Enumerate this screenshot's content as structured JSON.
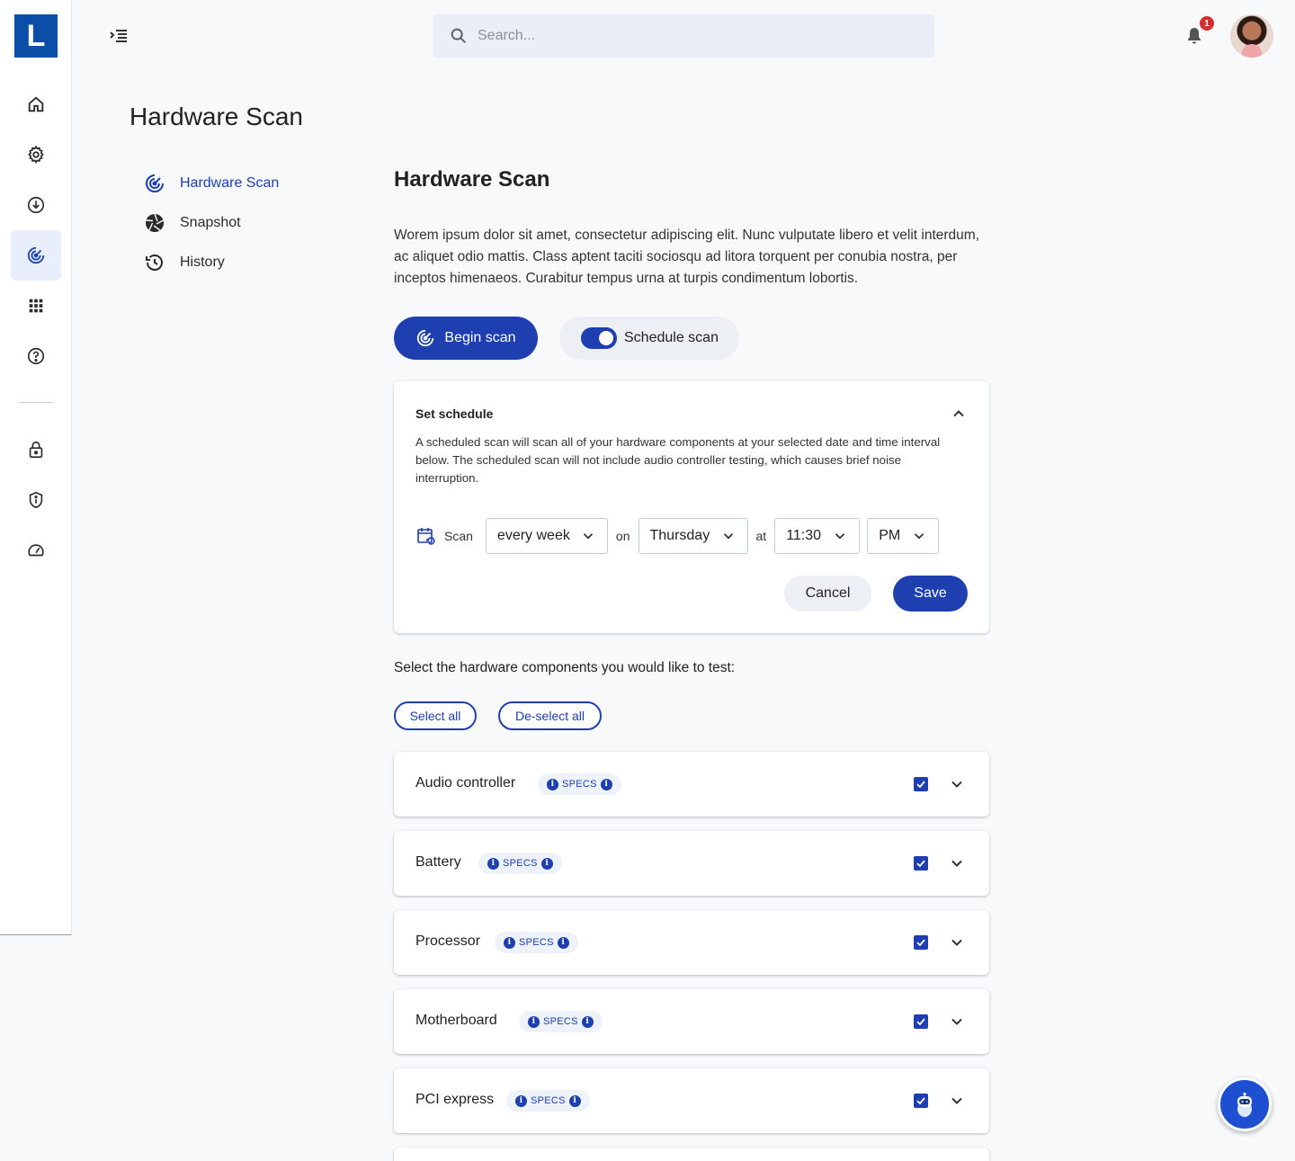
{
  "app": {
    "logo_letter": "L"
  },
  "topbar": {
    "search_placeholder": "Search...",
    "notification_count": "1"
  },
  "page": {
    "title": "Hardware Scan"
  },
  "subnav": {
    "items": [
      {
        "label": "Hardware Scan",
        "icon": "radar-icon",
        "active": true
      },
      {
        "label": "Snapshot",
        "icon": "aperture-icon",
        "active": false
      },
      {
        "label": "History",
        "icon": "history-icon",
        "active": false
      }
    ]
  },
  "main": {
    "title": "Hardware Scan",
    "description": "Worem ipsum dolor sit amet, consectetur adipiscing elit. Nunc vulputate libero et velit interdum, ac aliquet odio mattis. Class aptent taciti sociosqu ad litora torquent per conubia nostra, per inceptos himenaeos. Curabitur tempus urna at turpis condimentum lobortis.",
    "begin_scan_label": "Begin scan",
    "schedule_scan_label": "Schedule scan",
    "schedule_enabled": true
  },
  "schedule": {
    "title": "Set schedule",
    "text": "A scheduled scan will scan all of your hardware components at your selected date and time interval below. The scheduled scan will not include audio controller testing, which causes brief noise interruption.",
    "scan_label": "Scan",
    "frequency": "every week",
    "on_label": "on",
    "day": "Thursday",
    "at_label": "at",
    "time": "11:30",
    "period": "PM",
    "cancel_label": "Cancel",
    "save_label": "Save"
  },
  "components": {
    "heading": "Select the hardware components you would like to test:",
    "select_all_label": "Select all",
    "deselect_all_label": "De-select all",
    "specs_label": "SPECS",
    "items": [
      {
        "name": "Audio controller",
        "checked": true
      },
      {
        "name": "Battery",
        "checked": true
      },
      {
        "name": "Processor",
        "checked": true
      },
      {
        "name": "Motherboard",
        "checked": true
      },
      {
        "name": "PCI express",
        "checked": true
      }
    ]
  },
  "colors": {
    "primary": "#1d3fb0",
    "logo_bg": "#0b4ea8",
    "badge": "#d32f2f",
    "search_bg": "#e9eef7"
  }
}
